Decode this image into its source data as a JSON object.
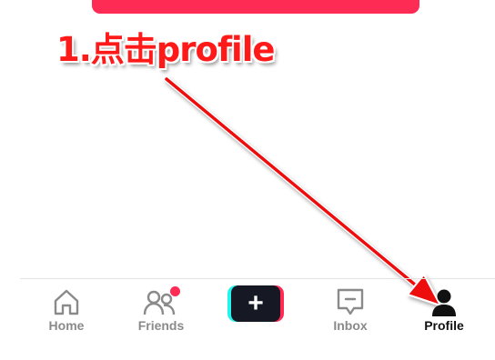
{
  "annotation": {
    "text": "1.点击profile",
    "color": "#ff1a1a"
  },
  "top_banner": {
    "color": "#fe2c55"
  },
  "tabbar": {
    "items": [
      {
        "id": "home",
        "label": "Home",
        "icon": "home-icon",
        "active": false
      },
      {
        "id": "friends",
        "label": "Friends",
        "icon": "friends-icon",
        "active": false,
        "badge": true
      },
      {
        "id": "create",
        "label": "+",
        "icon": "plus-icon",
        "active": false
      },
      {
        "id": "inbox",
        "label": "Inbox",
        "icon": "inbox-icon",
        "active": false
      },
      {
        "id": "profile",
        "label": "Profile",
        "icon": "person-icon",
        "active": true
      }
    ],
    "active_color": "#111111",
    "inactive_color": "#8a8a8a",
    "badge_color": "#fe2c55"
  }
}
